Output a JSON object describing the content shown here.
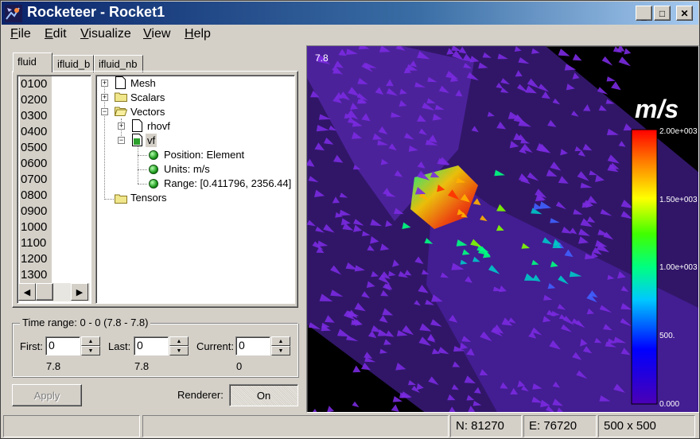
{
  "window": {
    "title": "Rocketeer - Rocket1",
    "controls": {
      "minimize": "_",
      "maximize": "□",
      "close": "✕"
    }
  },
  "menu": [
    {
      "label": "File",
      "accel": "F",
      "rest": "ile"
    },
    {
      "label": "Edit",
      "accel": "E",
      "rest": "dit"
    },
    {
      "label": "Visualize",
      "accel": "V",
      "rest": "isualize"
    },
    {
      "label": "View",
      "accel": "V",
      "rest": "iew"
    },
    {
      "label": "Help",
      "accel": "H",
      "rest": "elp"
    }
  ],
  "tabs": [
    "fluid",
    "ifluid_b",
    "ifluid_nb"
  ],
  "active_tab": "fluid",
  "blocks": [
    "0100",
    "0200",
    "0300",
    "0400",
    "0500",
    "0600",
    "0700",
    "0800",
    "0900",
    "1000",
    "1100",
    "1200",
    "1300"
  ],
  "tree": {
    "mesh": "Mesh",
    "scalars": "Scalars",
    "vectors": "Vectors",
    "rhovf": "rhovf",
    "vf": "vf",
    "position": "Position: Element",
    "units": "Units: m/s",
    "range": "Range: [0.411796, 2356.44]",
    "tensors": "Tensors"
  },
  "time_range": {
    "title": "Time range: 0 - 0 (7.8 - 7.8)",
    "first_label": "First:",
    "first_value": "0",
    "first_time": "7.8",
    "last_label": "Last:",
    "last_value": "0",
    "last_time": "7.8",
    "current_label": "Current:",
    "current_value": "0",
    "current_time": "0"
  },
  "apply_label": "Apply",
  "renderer_label": "Renderer:",
  "renderer_value": "On",
  "viewport": {
    "time_label": "7.8",
    "units": "m/s",
    "scale_labels": [
      "2.00e+003",
      "1.50e+003",
      "1.00e+003",
      "500.",
      "0.000"
    ]
  },
  "status": {
    "nodes": "N: 81270",
    "elements": "E: 76720",
    "size": "500 x 500"
  },
  "colors": {
    "titlebar_start": "#0a246a",
    "titlebar_end": "#a6caf0",
    "face": "#d4d0c8",
    "viewport_bg": "#000000",
    "vector_low": "#6a1fd6"
  }
}
